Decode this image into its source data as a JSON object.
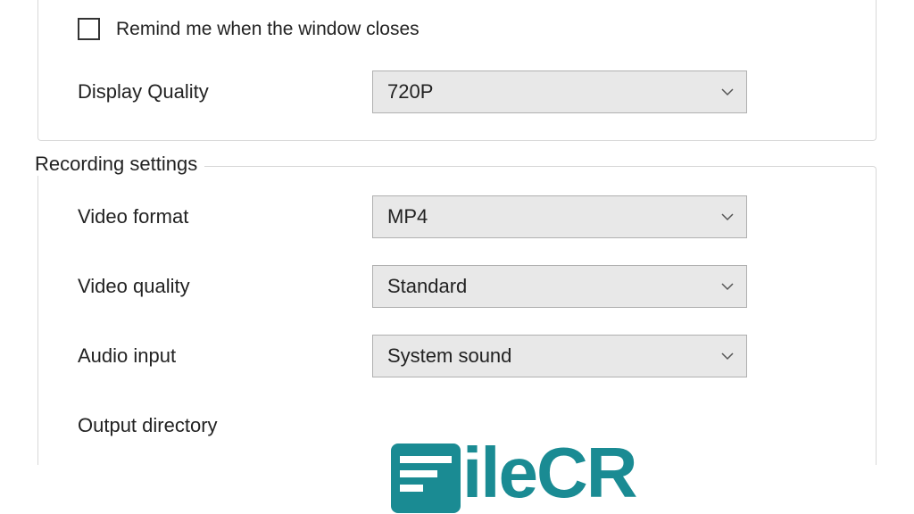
{
  "top_group": {
    "remind_label": "Remind me when the window closes",
    "display_quality_label": "Display Quality",
    "display_quality_value": "720P"
  },
  "recording_group": {
    "legend": "Recording settings",
    "video_format_label": "Video format",
    "video_format_value": "MP4",
    "video_quality_label": "Video quality",
    "video_quality_value": "Standard",
    "audio_input_label": "Audio input",
    "audio_input_value": "System sound",
    "output_directory_label": "Output directory"
  },
  "logo_text": "ileCR"
}
